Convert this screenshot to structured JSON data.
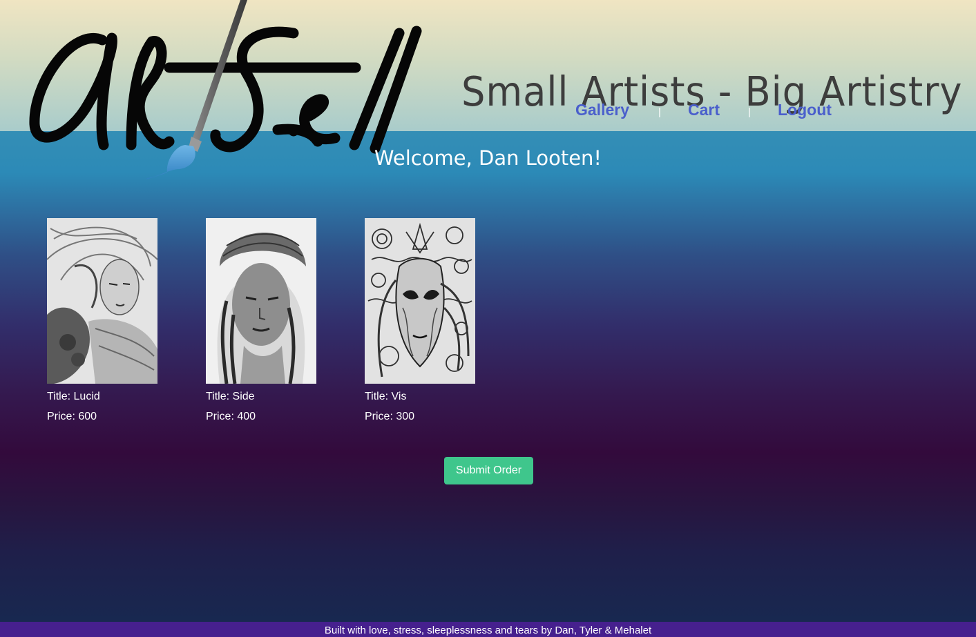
{
  "header": {
    "tagline": "Small Artists - Big Artistry",
    "logo_text": "ArtSell"
  },
  "nav": {
    "gallery": "Gallery",
    "separator": "|",
    "cart": "Cart",
    "logout": "Logout"
  },
  "welcome": "Welcome, Dan Looten!",
  "cart_items": [
    {
      "title_label": "Title: Lucid",
      "price_label": "Price:  600",
      "title": "Lucid",
      "price": 600
    },
    {
      "title_label": "Title: Side",
      "price_label": "Price:  400",
      "title": "Side",
      "price": 400
    },
    {
      "title_label": "Title: Vis",
      "price_label": "Price:  300",
      "title": "Vis",
      "price": 300
    }
  ],
  "submit_label": "Submit Order",
  "footer": "Built with love, stress, sleeplessness and tears by Dan, Tyler & Mehalet",
  "colors": {
    "nav_link": "#4a5fcc",
    "submit_button": "#3fc68c",
    "footer_bg": "#46208e",
    "tagline": "#3d3d3d"
  }
}
